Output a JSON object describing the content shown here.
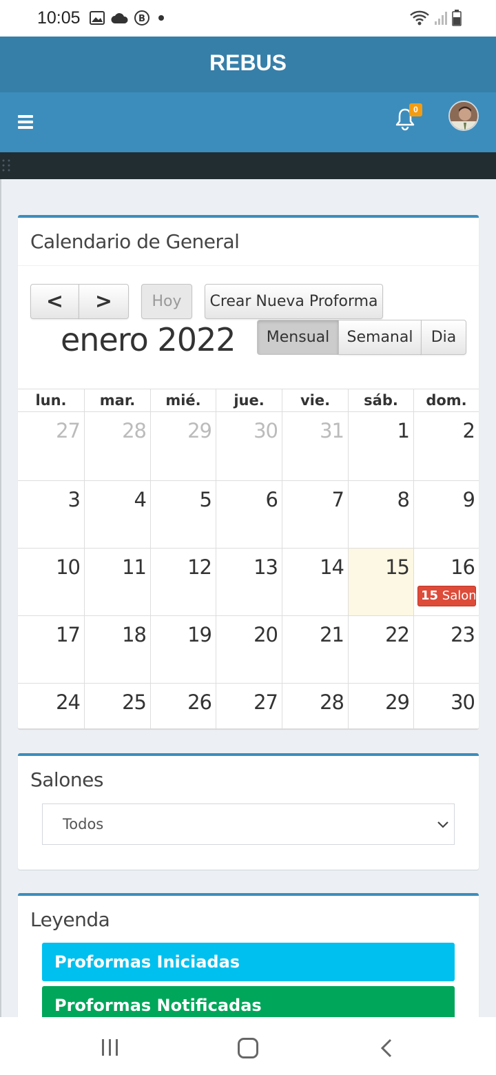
{
  "status_bar": {
    "time": "10:05",
    "icons_left": [
      "image-icon",
      "cloud-icon",
      "b-circle-icon",
      "dot-icon"
    ],
    "icons_right": [
      "wifi-icon",
      "signal-icon",
      "battery-icon"
    ]
  },
  "app": {
    "brand": "REBUS",
    "notifications_count": "0",
    "colors": {
      "primary": "#3c8dbc",
      "primary_dark": "#367fa9",
      "sidebar_dark": "#222d32",
      "badge": "#f39c12"
    }
  },
  "calendar": {
    "title": "Calendario de General",
    "prev_label": "<",
    "next_label": ">",
    "today_label": "Hoy",
    "create_label": "Crear Nueva Proforma",
    "month_label": "enero 2022",
    "views": {
      "month": "Mensual",
      "week": "Semanal",
      "day": "Dia"
    },
    "active_view": "Mensual",
    "weekdays": [
      "lun.",
      "mar.",
      "mié.",
      "jue.",
      "vie.",
      "sáb.",
      "dom."
    ],
    "weeks": [
      [
        {
          "d": "27",
          "other": true
        },
        {
          "d": "28",
          "other": true
        },
        {
          "d": "29",
          "other": true
        },
        {
          "d": "30",
          "other": true
        },
        {
          "d": "31",
          "other": true
        },
        {
          "d": "1"
        },
        {
          "d": "2"
        }
      ],
      [
        {
          "d": "3"
        },
        {
          "d": "4"
        },
        {
          "d": "5"
        },
        {
          "d": "6"
        },
        {
          "d": "7"
        },
        {
          "d": "8"
        },
        {
          "d": "9"
        }
      ],
      [
        {
          "d": "10"
        },
        {
          "d": "11"
        },
        {
          "d": "12"
        },
        {
          "d": "13"
        },
        {
          "d": "14"
        },
        {
          "d": "15",
          "today": true
        },
        {
          "d": "16",
          "event": {
            "time": "15",
            "title": "Salon"
          }
        }
      ],
      [
        {
          "d": "17"
        },
        {
          "d": "18"
        },
        {
          "d": "19"
        },
        {
          "d": "20"
        },
        {
          "d": "21"
        },
        {
          "d": "22"
        },
        {
          "d": "23"
        }
      ],
      [
        {
          "d": "24"
        },
        {
          "d": "25"
        },
        {
          "d": "26"
        },
        {
          "d": "27"
        },
        {
          "d": "28"
        },
        {
          "d": "29"
        },
        {
          "d": "30"
        }
      ]
    ],
    "event_color": "#dd4b39",
    "today_color": "#fcf8e3"
  },
  "salones": {
    "title": "Salones",
    "selected": "Todos"
  },
  "leyenda": {
    "title": "Leyenda",
    "items": [
      {
        "label": "Proformas Iniciadas",
        "color": "#00c0ef"
      },
      {
        "label": "Proformas Notificadas",
        "color": "#00a65a"
      }
    ]
  }
}
